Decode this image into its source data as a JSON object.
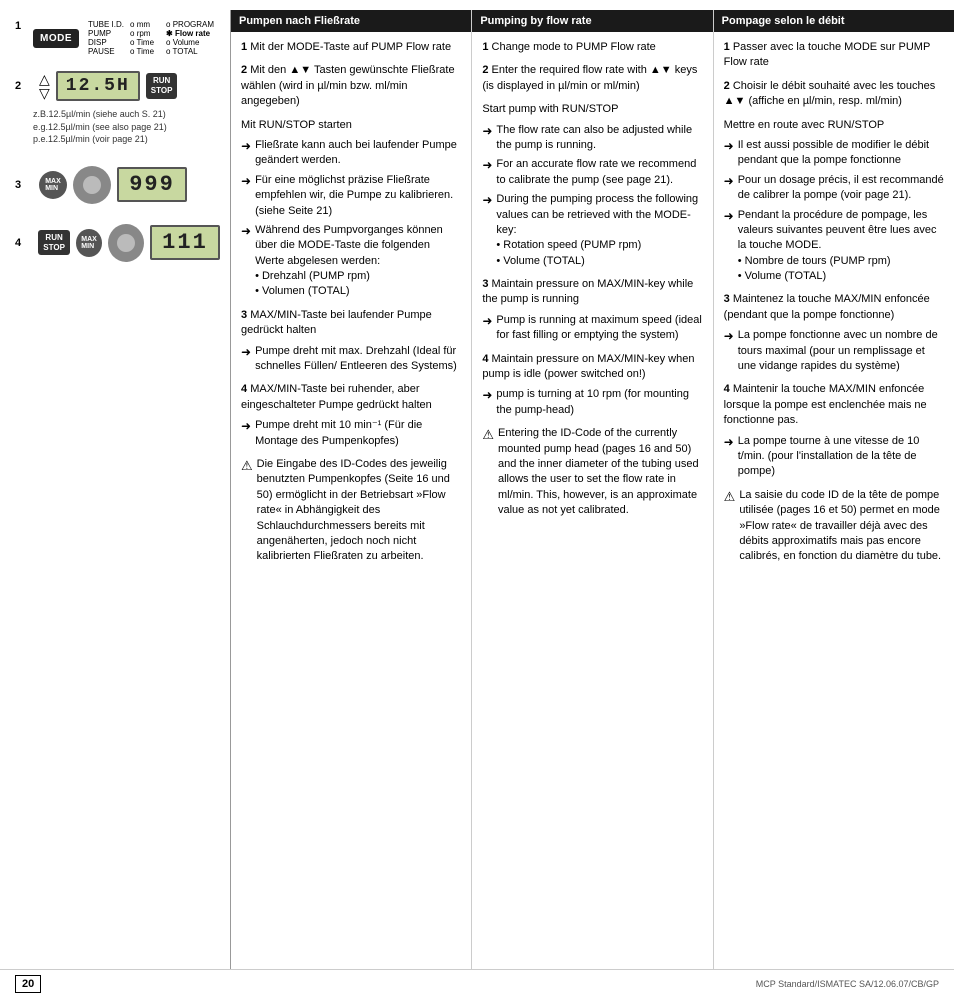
{
  "page": {
    "number": "20",
    "doc_ref": "MCP Standard/ISMATEC SA/12.06.07/CB/GP"
  },
  "columns": {
    "col1": {
      "header": "Pumpen nach Fließrate",
      "steps": [
        {
          "num": "1",
          "text": "Mit der MODE-Taste auf PUMP Flow rate"
        },
        {
          "num": "2",
          "text": "Mit den ▲▼ Tasten gewünschte Fließrate wählen (wird in µl/min bzw. ml/min angegeben)"
        },
        {
          "sub_intro": "Mit RUN/STOP starten",
          "bullets": [
            "Fließrate kann auch bei laufender Pumpe geändert werden.",
            "Für eine möglichst präzise Fließrate empfehlen wir, die Pumpe zu kalibrieren. (siehe Seite 21)",
            "Während des Pumpvorganges können über die MODE-Taste die folgenden Werte abgelesen werden: • Drehzahl (PUMP rpm) • Volumen (TOTAL)"
          ]
        },
        {
          "num": "3",
          "text": "MAX/MIN-Taste bei laufender Pumpe gedrückt halten",
          "bullets": [
            "Pumpe dreht mit max. Drehzahl (Ideal für schnelles Füllen/ Entleeren des Systems)"
          ]
        },
        {
          "num": "4",
          "text": "MAX/MIN-Taste bei ruhender, aber eingeschalteter Pumpe gedrückt halten",
          "bullets": [
            "Pumpe dreht mit 10 min⁻¹ (Für die Montage des Pumpenkopfes)"
          ]
        }
      ],
      "warning": "⚠ Die Eingabe des ID-Codes des jeweilig benutzten Pumpenkopfes (Seite 16 und 50) ermöglicht in der Betriebsart »Flow rate« in Abhängigkeit des Schlauchdurchmessers bereits mit angenäherten, jedoch noch nicht kalibrierten Fließraten zu arbeiten."
    },
    "col2": {
      "header": "Pumping by flow rate",
      "steps": [
        {
          "num": "1",
          "text": "Change mode to PUMP Flow rate"
        },
        {
          "num": "2",
          "text": "Enter the required flow rate with ▲▼ keys (is displayed in µl/min or ml/min)"
        },
        {
          "sub_intro": "Start pump with RUN/STOP",
          "bullets": [
            "The flow rate can also be adjusted while the pump is running.",
            "For an accurate flow rate we recommend to calibrate the pump (see page 21).",
            "During the pumping process the following values can be retrieved with the MODE-key: • Rotation speed (PUMP rpm) • Volume (TOTAL)"
          ]
        },
        {
          "num": "3",
          "text": "Maintain pressure on MAX/MIN-key while the pump is running",
          "bullets": [
            "Pump is running at maximum speed (ideal for fast filling or emptying the system)"
          ]
        },
        {
          "num": "4",
          "text": "Maintain pressure on MAX/MIN-key when pump is idle (power switched on!)",
          "bullets": [
            "pump is turning at 10 rpm (for mounting the pump-head)"
          ]
        }
      ],
      "warning": "⚠ Entering the ID-Code of the currently mounted pump head (pages 16 and 50) and the inner diameter of the tubing used allows the user to set the flow rate in ml/min. This, however, is an approximate value as not yet calibrated."
    },
    "col3": {
      "header": "Pompage selon le débit",
      "steps": [
        {
          "num": "1",
          "text": "Passer avec la touche MODE sur PUMP Flow rate"
        },
        {
          "num": "2",
          "text": "Choisir le débit souhaité avec les touches ▲▼ (affiche en µl/min, resp. ml/min)"
        },
        {
          "sub_intro": "Mettre en route avec RUN/STOP",
          "bullets": [
            "Il est aussi possible de modifier le débit pendant que la pompe fonctionne",
            "Pour un dosage précis, il est recommandé de calibrer la pompe (voir page 21).",
            "Pendant la procédure de pompage, les valeurs suivantes peuvent être lues avec la touche MODE. • Nombre de tours (PUMP rpm) • Volume (TOTAL)"
          ]
        },
        {
          "num": "3",
          "text": "Maintenez la touche MAX/MIN enfoncée (pendant que la pompe fonctionne)",
          "bullets": [
            "La pompe fonctionne avec un nombre de tours maximal (pour un remplissage et une vidange rapides du système)"
          ]
        },
        {
          "num": "4",
          "text": "Maintenir la touche MAX/MIN enfoncée lorsque la pompe est enclenchée mais ne fonctionne pas.",
          "bullets": [
            "La pompe tourne à une vitesse de 10 t/min. (pour l'installation de la tête de pompe)"
          ]
        }
      ],
      "warning": "⚠ La saisie du code ID de la tête de pompe utilisée (pages 16 et 50) permet en mode »Flow rate« de travailler déjà avec des débits approximatifs mais pas encore calibrés, en fonction du diamètre du tube."
    }
  },
  "diagrams": {
    "row1": {
      "step": "1",
      "label": "MODE",
      "tube_labels": [
        "TUBE I.D.",
        "PUMP",
        "DISP",
        "PAUSE"
      ],
      "tube_values_left": [
        "o mm",
        "o rpm",
        "o Time",
        "o Time"
      ],
      "tube_values_right": [
        "o PROGRAM",
        "✱ Flow rate",
        "o Volume",
        "o TOTAL"
      ]
    },
    "row2": {
      "step": "2",
      "display": "12.5H",
      "notes": "z.B.12.5µl/min (siehe auch S. 21)\ne.g.12.5µl/min (see also page 21)\np.e.12.5µl/min (voir page 21)"
    },
    "row3": {
      "step": "3",
      "display": "999"
    },
    "row4": {
      "step": "4",
      "display": "111"
    }
  }
}
